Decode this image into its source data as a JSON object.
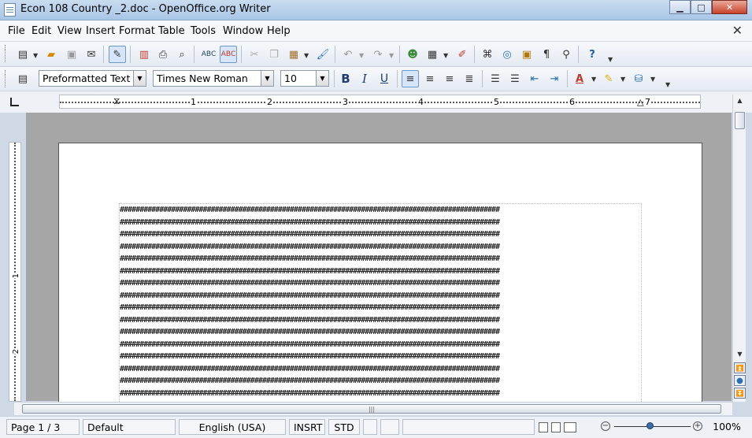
{
  "window": {
    "title": "Econ 108 Country _2.doc - OpenOffice.org Writer",
    "minimize": "▁",
    "maximize": "□",
    "close": "✕"
  },
  "menu": [
    "File",
    "Edit",
    "View",
    "Insert",
    "Format",
    "Table",
    "Tools",
    "Window",
    "Help"
  ],
  "doc_close": "✕",
  "toolbar2": {
    "style": "Preformatted Text",
    "font": "Times New Roman",
    "size": "10",
    "bold": "B",
    "italic": "I",
    "underline": "U"
  },
  "ruler": {
    "h_numbers": [
      "1",
      "2",
      "3",
      "4",
      "5",
      "6",
      "7"
    ],
    "v_numbers": [
      "1",
      "2"
    ]
  },
  "document": {
    "line_text": "################################################################################################",
    "line_count": 16
  },
  "statusbar": {
    "page": "Page 1 / 3",
    "page_style": "Default",
    "language": "English (USA)",
    "insert_mode": "INSRT",
    "selection_mode": "STD",
    "zoom": "100%"
  }
}
